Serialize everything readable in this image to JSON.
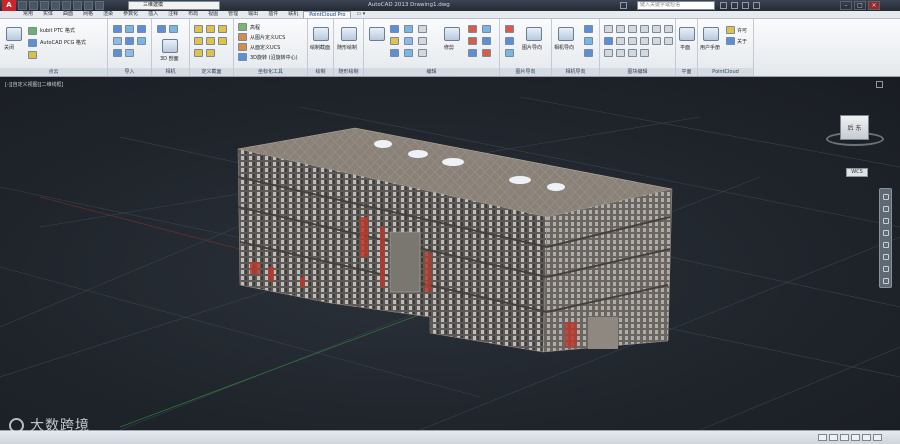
{
  "titlebar": {
    "app_logo": "A",
    "workspace": "三维建模",
    "window_title": "AutoCAD 2013    Drawing1.dwg",
    "search_placeholder": "键入关键字或短语"
  },
  "tabs": [
    "常用",
    "实体",
    "曲面",
    "网格",
    "渲染",
    "参数化",
    "插入",
    "注释",
    "布局",
    "视图",
    "管理",
    "输出",
    "插件",
    "联机",
    "PointCloud Pro",
    "▭ ▾"
  ],
  "active_tab": "PointCloud Pro",
  "ribbon": {
    "panels": [
      {
        "title": "点云",
        "labels": [
          "关闭",
          "kubit PTC 格式",
          "AutoCAD PCG 格式"
        ]
      },
      {
        "title": "导入",
        "labels": []
      },
      {
        "title": "相机",
        "labels": []
      },
      {
        "title": "定义截面",
        "labels": [
          "3D 剖面"
        ]
      },
      {
        "title": "坐标化工具",
        "labels": [
          "高程",
          "从图片定义UCS",
          "从面定义UCS",
          "3D旋转 (沿旋转中心)"
        ]
      },
      {
        "title": "绘制",
        "labels": [
          "绘制截面"
        ]
      },
      {
        "title": "随形绘制",
        "labels": [
          "随形绘制"
        ]
      },
      {
        "title": "编辑",
        "labels": [
          "参数线",
          "修剪"
        ]
      },
      {
        "title": "图片导向",
        "labels": [
          "图片导向"
        ]
      },
      {
        "title": "相机导向",
        "labels": [
          "相机导向"
        ]
      },
      {
        "title": "图块编辑",
        "labels": []
      },
      {
        "title": "平面",
        "labels": [
          "平面"
        ]
      },
      {
        "title": "PointCloud",
        "labels": [
          "用户手册",
          "许可",
          "关于"
        ]
      }
    ]
  },
  "viewport": {
    "label": "[-][自定义视图][二维线框]",
    "viewcube_face": "后 东",
    "wcs": "WCS"
  },
  "status": {
    "watermark": "大数跨境"
  },
  "colors": {
    "accent": "#c8262b",
    "viewport_bg": "#23282f",
    "ribbon_bg": "#eef1f4"
  }
}
